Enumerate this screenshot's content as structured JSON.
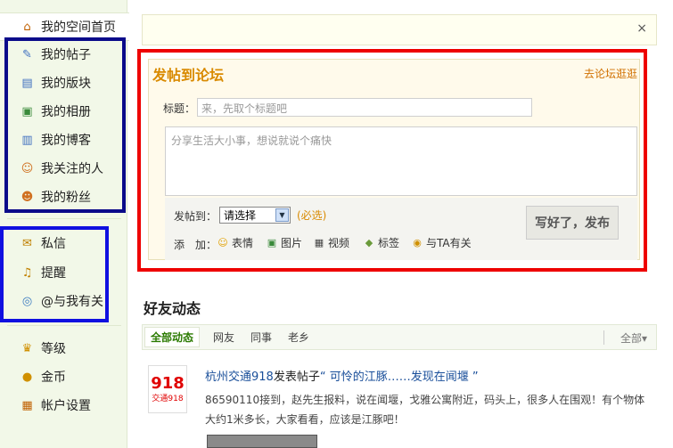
{
  "sidebar": {
    "items": [
      {
        "label": "我的空间首页",
        "icon": "home-icon"
      },
      {
        "label": "我的帖子",
        "icon": "post-icon"
      },
      {
        "label": "我的版块",
        "icon": "board-icon"
      },
      {
        "label": "我的相册",
        "icon": "album-icon"
      },
      {
        "label": "我的博客",
        "icon": "blog-icon"
      },
      {
        "label": "我关注的人",
        "icon": "following-icon"
      },
      {
        "label": "我的粉丝",
        "icon": "fans-icon"
      },
      {
        "label": "私信",
        "icon": "mail-icon"
      },
      {
        "label": "提醒",
        "icon": "bell-icon"
      },
      {
        "label": "@与我有关",
        "icon": "mention-icon"
      },
      {
        "label": "等级",
        "icon": "crown-icon"
      },
      {
        "label": "金币",
        "icon": "coin-icon"
      },
      {
        "label": "帐户设置",
        "icon": "account-icon"
      }
    ]
  },
  "notice": {
    "close": "×"
  },
  "post": {
    "title": "发帖到论坛",
    "forum_link": "去论坛逛逛",
    "title_label": "标题：",
    "title_placeholder": "来，先取个标题吧",
    "content_placeholder": "分享生活大小事，想说就说个痛快",
    "post_to_label": "发帖到：",
    "post_to_value": "请选择",
    "optional": "(必选)",
    "add_label": "添　加：",
    "attachments": [
      {
        "label": "表情",
        "icon": "smiley-icon"
      },
      {
        "label": "图片",
        "icon": "image-icon"
      },
      {
        "label": "视频",
        "icon": "video-icon"
      },
      {
        "label": "标签",
        "icon": "tag-icon"
      },
      {
        "label": "与TA有关",
        "icon": "mention-small-icon"
      }
    ],
    "publish": "写好了，发布"
  },
  "feed": {
    "title": "好友动态",
    "tabs": [
      "全部动态",
      "网友",
      "同事",
      "老乡"
    ],
    "all": "全部▾",
    "item": {
      "logo_top": "918",
      "logo_bottom": "交通918",
      "author": "杭州交通918",
      "action": "发表帖子",
      "quote_open": "“",
      "post_title": "可怜的江豚……发现在闻堰",
      "quote_close": "”",
      "text": "86590110接到，赵先生报料，说在闻堰，戈雅公寓附近，码头上，很多人在围观！有个物体大约1米多长，大家看看，应该是江豚吧！"
    }
  },
  "colors": {
    "sidebar_bg": "#f2f8e8",
    "accent_orange": "#d98a00",
    "link_blue": "#1a4f9a",
    "highlight_red": "#ee0000",
    "highlight_navy": "#0b0b8a",
    "highlight_blue": "#1010e0"
  }
}
